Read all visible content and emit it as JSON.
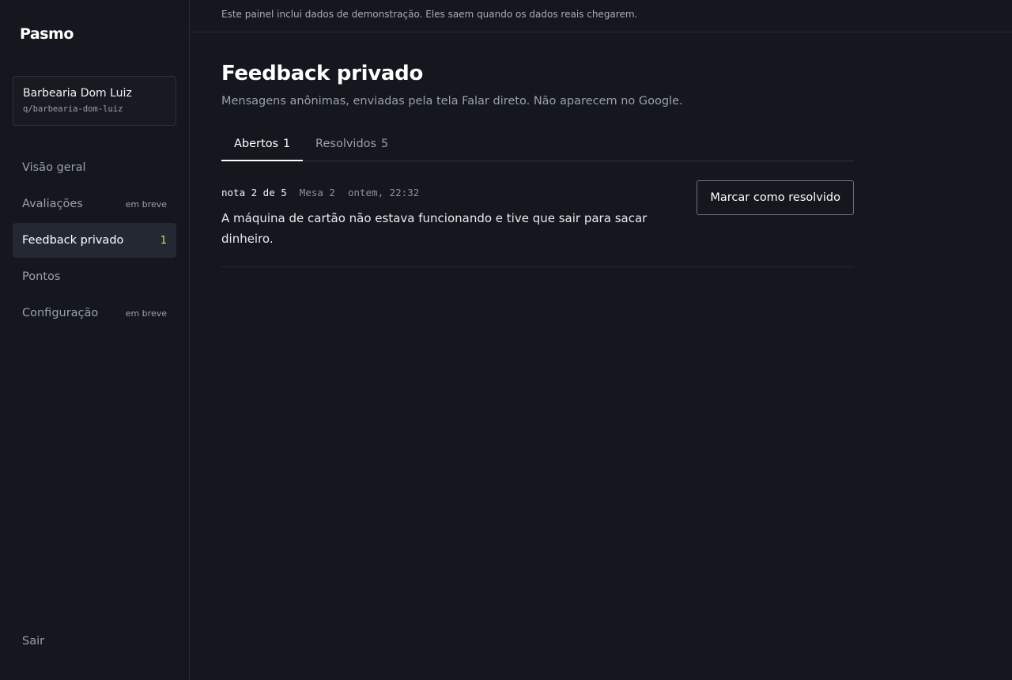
{
  "app": {
    "logo": "Pasmo"
  },
  "business": {
    "name": "Barbearia Dom Luiz",
    "slug": "q/barbearia-dom-luiz"
  },
  "sidebar": {
    "items": [
      {
        "label": "Visão geral",
        "badge": ""
      },
      {
        "label": "Avaliações",
        "badge": "em breve"
      },
      {
        "label": "Feedback privado",
        "count": "1",
        "active": true
      },
      {
        "label": "Pontos",
        "badge": ""
      },
      {
        "label": "Configuração",
        "badge": "em breve"
      }
    ],
    "logout": "Sair"
  },
  "banner": {
    "text": "Este painel inclui dados de demonstração. Eles saem quando os dados reais chegarem."
  },
  "page": {
    "title": "Feedback privado",
    "subtitle": "Mensagens anônimas, enviadas pela tela Falar direto. Não aparecem no Google."
  },
  "tabs": [
    {
      "label": "Abertos",
      "count": "1",
      "active": true
    },
    {
      "label": "Resolvidos",
      "count": "5",
      "active": false
    }
  ],
  "feedback": [
    {
      "rating": "nota 2 de 5",
      "table": "Mesa 2",
      "time": "ontem, 22:32",
      "message": "A máquina de cartão não estava funcionando e tive que sair para sacar dinheiro.",
      "action_label": "Marcar como resolvido"
    }
  ],
  "colors": {
    "accent": "#d8e048",
    "background": "#14171e"
  }
}
